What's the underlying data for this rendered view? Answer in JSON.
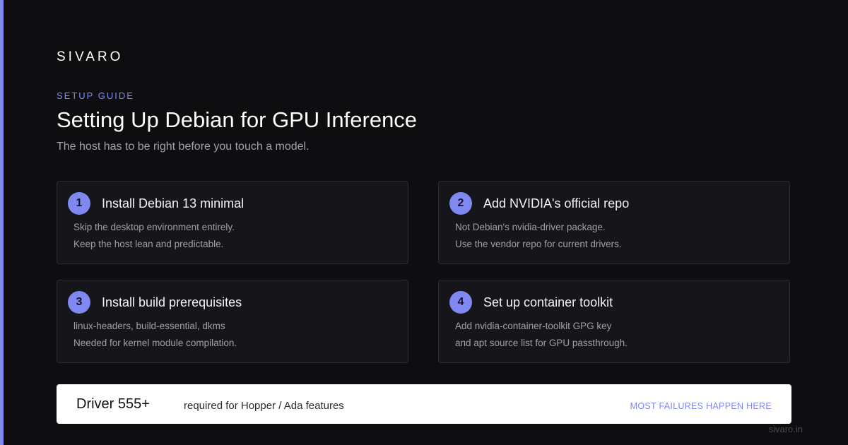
{
  "brand": "SIVARO",
  "eyebrow": "SETUP GUIDE",
  "title": "Setting Up Debian for GPU Inference",
  "subtitle": "The host has to be right before you touch a model.",
  "steps": [
    {
      "number": "1",
      "title": "Install Debian 13 minimal",
      "line1": "Skip the desktop environment entirely.",
      "line2": "Keep the host lean and predictable."
    },
    {
      "number": "2",
      "title": "Add NVIDIA's official repo",
      "line1": "Not Debian's nvidia-driver package.",
      "line2": "Use the vendor repo for current drivers."
    },
    {
      "number": "3",
      "title": "Install build prerequisites",
      "line1": "linux-headers, build-essential, dkms",
      "line2": "Needed for kernel module compilation."
    },
    {
      "number": "4",
      "title": "Set up container toolkit",
      "line1": "Add nvidia-container-toolkit GPG key",
      "line2": "and apt source list for GPU passthrough."
    }
  ],
  "callout": {
    "main": "Driver 555+",
    "description": "required for Hopper / Ada features",
    "note": "MOST FAILURES HAPPEN HERE"
  },
  "footer": "sivaro.in",
  "colors": {
    "accent": "#8088f2",
    "background": "#0e0e10",
    "card": "#16161a",
    "callout_bg": "#ffffff"
  }
}
